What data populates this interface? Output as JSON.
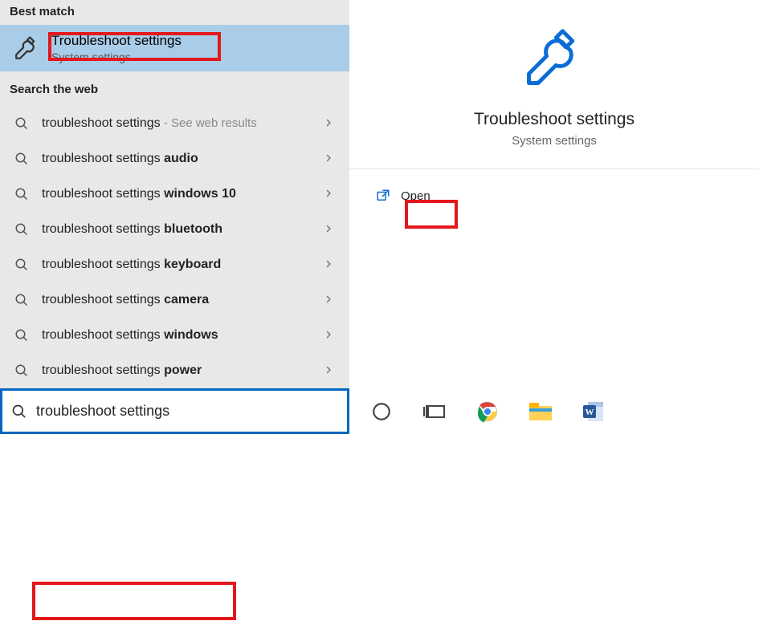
{
  "left": {
    "best_match_header": "Best match",
    "best": {
      "title": "Troubleshoot settings",
      "subtitle": "System settings"
    },
    "search_web_header": "Search the web",
    "web_items": [
      {
        "prefix": "troubleshoot settings",
        "bold": "",
        "suffix": " - See web results",
        "see_web": true
      },
      {
        "prefix": "troubleshoot settings ",
        "bold": "audio",
        "suffix": ""
      },
      {
        "prefix": "troubleshoot settings ",
        "bold": "windows 10",
        "suffix": ""
      },
      {
        "prefix": "troubleshoot settings ",
        "bold": "bluetooth",
        "suffix": ""
      },
      {
        "prefix": "troubleshoot settings ",
        "bold": "keyboard",
        "suffix": ""
      },
      {
        "prefix": "troubleshoot settings ",
        "bold": "camera",
        "suffix": ""
      },
      {
        "prefix": "troubleshoot settings ",
        "bold": "windows",
        "suffix": ""
      },
      {
        "prefix": "troubleshoot settings ",
        "bold": "power",
        "suffix": ""
      }
    ]
  },
  "right": {
    "title": "Troubleshoot settings",
    "subtitle": "System settings",
    "open_label": "Open"
  },
  "taskbar": {
    "search_value": "troubleshoot settings"
  }
}
